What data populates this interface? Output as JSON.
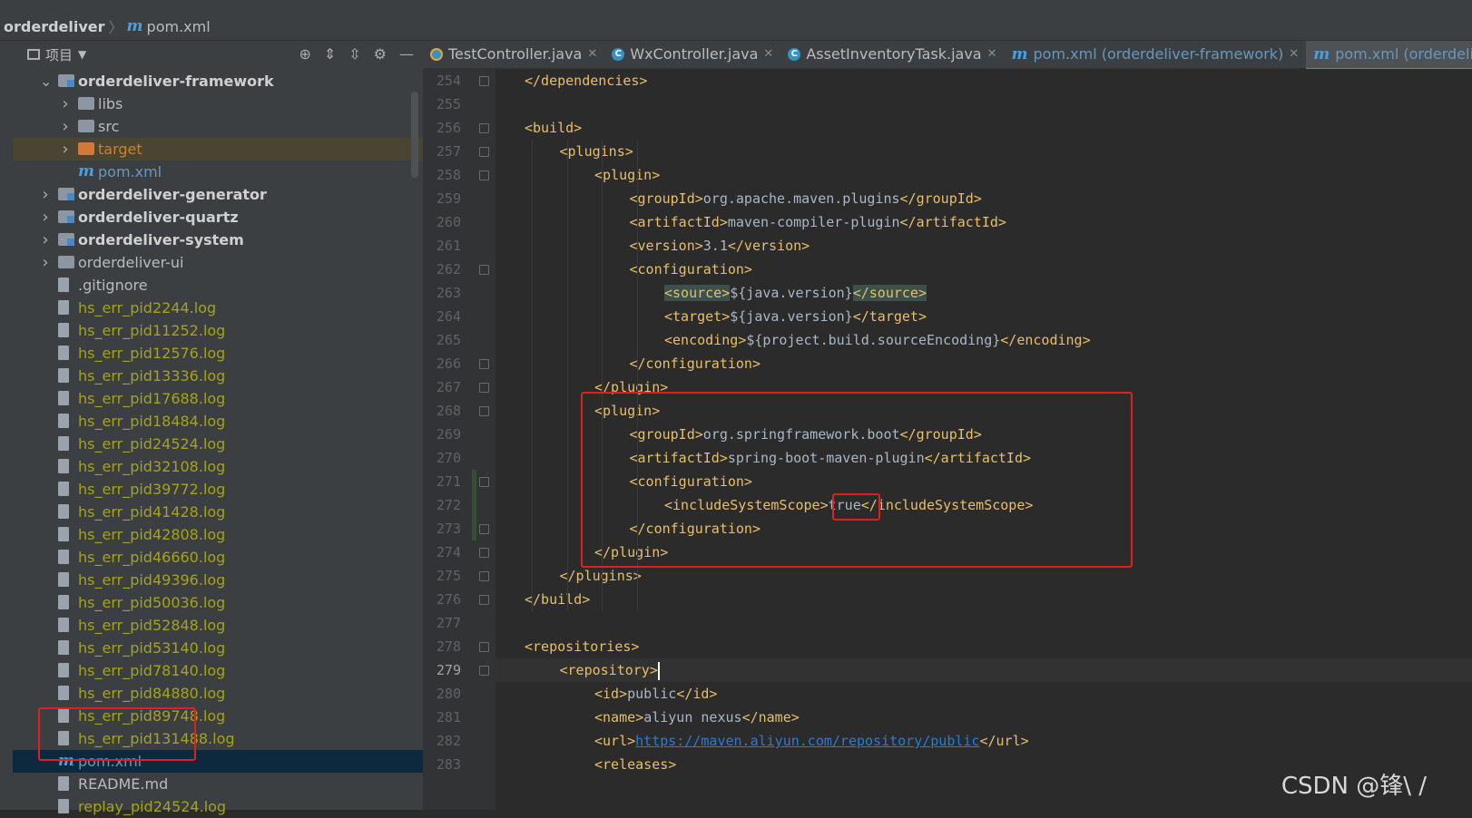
{
  "breadcrumb": {
    "project": "orderdeliver",
    "file_icon": "m",
    "file": "pom.xml"
  },
  "panel": {
    "title": "项目"
  },
  "tree": [
    {
      "label": "orderdeliver-framework",
      "level": 1,
      "expanded": true,
      "type": "module",
      "bold": true
    },
    {
      "label": "libs",
      "level": 2,
      "expanded": false,
      "type": "folder"
    },
    {
      "label": "src",
      "level": 2,
      "expanded": false,
      "type": "folder"
    },
    {
      "label": "target",
      "level": 2,
      "expanded": false,
      "type": "target"
    },
    {
      "label": "pom.xml",
      "level": 2,
      "type": "pom"
    },
    {
      "label": "orderdeliver-generator",
      "level": 1,
      "expanded": false,
      "type": "module",
      "bold": true
    },
    {
      "label": "orderdeliver-quartz",
      "level": 1,
      "expanded": false,
      "type": "module",
      "bold": true
    },
    {
      "label": "orderdeliver-system",
      "level": 1,
      "expanded": false,
      "type": "module",
      "bold": true
    },
    {
      "label": "orderdeliver-ui",
      "level": 1,
      "expanded": false,
      "type": "folder"
    },
    {
      "label": ".gitignore",
      "level": 1,
      "type": "file"
    },
    {
      "label": "hs_err_pid2244.log",
      "level": 1,
      "type": "log"
    },
    {
      "label": "hs_err_pid11252.log",
      "level": 1,
      "type": "log"
    },
    {
      "label": "hs_err_pid12576.log",
      "level": 1,
      "type": "log"
    },
    {
      "label": "hs_err_pid13336.log",
      "level": 1,
      "type": "log"
    },
    {
      "label": "hs_err_pid17688.log",
      "level": 1,
      "type": "log"
    },
    {
      "label": "hs_err_pid18484.log",
      "level": 1,
      "type": "log"
    },
    {
      "label": "hs_err_pid24524.log",
      "level": 1,
      "type": "log"
    },
    {
      "label": "hs_err_pid32108.log",
      "level": 1,
      "type": "log"
    },
    {
      "label": "hs_err_pid39772.log",
      "level": 1,
      "type": "log"
    },
    {
      "label": "hs_err_pid41428.log",
      "level": 1,
      "type": "log"
    },
    {
      "label": "hs_err_pid42808.log",
      "level": 1,
      "type": "log"
    },
    {
      "label": "hs_err_pid46660.log",
      "level": 1,
      "type": "log"
    },
    {
      "label": "hs_err_pid49396.log",
      "level": 1,
      "type": "log"
    },
    {
      "label": "hs_err_pid50036.log",
      "level": 1,
      "type": "log"
    },
    {
      "label": "hs_err_pid52848.log",
      "level": 1,
      "type": "log"
    },
    {
      "label": "hs_err_pid53140.log",
      "level": 1,
      "type": "log"
    },
    {
      "label": "hs_err_pid78140.log",
      "level": 1,
      "type": "log"
    },
    {
      "label": "hs_err_pid84880.log",
      "level": 1,
      "type": "log"
    },
    {
      "label": "hs_err_pid89748.log",
      "level": 1,
      "type": "log"
    },
    {
      "label": "hs_err_pid131488.log",
      "level": 1,
      "type": "log"
    },
    {
      "label": "pom.xml",
      "level": 1,
      "type": "pom",
      "selected": true
    },
    {
      "label": "README.md",
      "level": 1,
      "type": "file"
    },
    {
      "label": "replay_pid24524.log",
      "level": 1,
      "type": "log"
    }
  ],
  "tabs": [
    {
      "label": "TestController.java",
      "kind": "java"
    },
    {
      "label": "WxController.java",
      "kind": "class"
    },
    {
      "label": "AssetInventoryTask.java",
      "kind": "class"
    },
    {
      "label": "pom.xml (orderdeliver-framework)",
      "kind": "pom"
    },
    {
      "label": "pom.xml (orderdeliver)",
      "kind": "pom",
      "active": true
    }
  ],
  "editor": {
    "current_line": 279,
    "lines": [
      {
        "n": 254,
        "indent": 1,
        "parts": [
          [
            "tag",
            "</dependencies>"
          ]
        ]
      },
      {
        "n": 255,
        "indent": 0,
        "parts": []
      },
      {
        "n": 256,
        "indent": 1,
        "parts": [
          [
            "tag",
            "<build>"
          ]
        ]
      },
      {
        "n": 257,
        "indent": 2,
        "parts": [
          [
            "tag",
            "<plugins>"
          ]
        ]
      },
      {
        "n": 258,
        "indent": 3,
        "parts": [
          [
            "tag",
            "<plugin>"
          ]
        ]
      },
      {
        "n": 259,
        "indent": 4,
        "parts": [
          [
            "tag",
            "<groupId>"
          ],
          [
            "tx",
            "org.apache.maven.plugins"
          ],
          [
            "tag",
            "</groupId>"
          ]
        ]
      },
      {
        "n": 260,
        "indent": 4,
        "parts": [
          [
            "tag",
            "<artifactId>"
          ],
          [
            "tx",
            "maven-compiler-plugin"
          ],
          [
            "tag",
            "</artifactId>"
          ]
        ]
      },
      {
        "n": 261,
        "indent": 4,
        "parts": [
          [
            "tag",
            "<version>"
          ],
          [
            "tx",
            "3.1"
          ],
          [
            "tag",
            "</version>"
          ]
        ]
      },
      {
        "n": 262,
        "indent": 4,
        "parts": [
          [
            "tag",
            "<configuration>"
          ]
        ]
      },
      {
        "n": 263,
        "indent": 5,
        "parts": [
          [
            "taghl",
            "<source>"
          ],
          [
            "tx",
            "${java.version}"
          ],
          [
            "taghl",
            "</source>"
          ]
        ]
      },
      {
        "n": 264,
        "indent": 5,
        "parts": [
          [
            "tag",
            "<target>"
          ],
          [
            "tx",
            "${java.version}"
          ],
          [
            "tag",
            "</target>"
          ]
        ]
      },
      {
        "n": 265,
        "indent": 5,
        "parts": [
          [
            "tag",
            "<encoding>"
          ],
          [
            "tx",
            "${project.build.sourceEncoding}"
          ],
          [
            "tag",
            "</encoding>"
          ]
        ]
      },
      {
        "n": 266,
        "indent": 4,
        "parts": [
          [
            "tag",
            "</configuration>"
          ]
        ]
      },
      {
        "n": 267,
        "indent": 3,
        "parts": [
          [
            "tag",
            "</plugin>"
          ]
        ]
      },
      {
        "n": 268,
        "indent": 3,
        "parts": [
          [
            "tag",
            "<plugin>"
          ]
        ]
      },
      {
        "n": 269,
        "indent": 4,
        "parts": [
          [
            "tag",
            "<groupId>"
          ],
          [
            "tx",
            "org.springframework.boot"
          ],
          [
            "tag",
            "</groupId>"
          ]
        ]
      },
      {
        "n": 270,
        "indent": 4,
        "parts": [
          [
            "tag",
            "<artifactId>"
          ],
          [
            "tx",
            "spring-boot-maven-plugin"
          ],
          [
            "tag",
            "</artifactId>"
          ]
        ]
      },
      {
        "n": 271,
        "indent": 4,
        "parts": [
          [
            "tag",
            "<configuration>"
          ]
        ]
      },
      {
        "n": 272,
        "indent": 5,
        "parts": [
          [
            "tag",
            "<includeSystemScope>"
          ],
          [
            "tx",
            "true"
          ],
          [
            "tag",
            "</includeSystemScope>"
          ]
        ]
      },
      {
        "n": 273,
        "indent": 4,
        "parts": [
          [
            "tag",
            "</configuration>"
          ]
        ]
      },
      {
        "n": 274,
        "indent": 3,
        "parts": [
          [
            "tag",
            "</plugin>"
          ]
        ]
      },
      {
        "n": 275,
        "indent": 2,
        "parts": [
          [
            "tag",
            "</plugins>"
          ]
        ]
      },
      {
        "n": 276,
        "indent": 1,
        "parts": [
          [
            "tag",
            "</build>"
          ]
        ]
      },
      {
        "n": 277,
        "indent": 0,
        "parts": []
      },
      {
        "n": 278,
        "indent": 1,
        "parts": [
          [
            "tag",
            "<repositories>"
          ]
        ]
      },
      {
        "n": 279,
        "indent": 2,
        "parts": [
          [
            "tag",
            "<repository>"
          ]
        ]
      },
      {
        "n": 280,
        "indent": 3,
        "parts": [
          [
            "tag",
            "<id>"
          ],
          [
            "tx",
            "public"
          ],
          [
            "tag",
            "</id>"
          ]
        ]
      },
      {
        "n": 281,
        "indent": 3,
        "parts": [
          [
            "tag",
            "<name>"
          ],
          [
            "tx",
            "aliyun nexus"
          ],
          [
            "tag",
            "</name>"
          ]
        ]
      },
      {
        "n": 282,
        "indent": 3,
        "parts": [
          [
            "tag",
            "<url>"
          ],
          [
            "url",
            "https://maven.aliyun.com/repository/public"
          ],
          [
            "tag",
            "</url>"
          ]
        ]
      },
      {
        "n": 283,
        "indent": 3,
        "parts": [
          [
            "tag",
            "<releases>"
          ]
        ]
      }
    ]
  },
  "watermark": "CSDN @锋\\ /",
  "colors": {
    "highlight": "#e02020",
    "tag": "#e8bf6a",
    "text": "#a9b7c6",
    "log": "#a4a21f"
  }
}
